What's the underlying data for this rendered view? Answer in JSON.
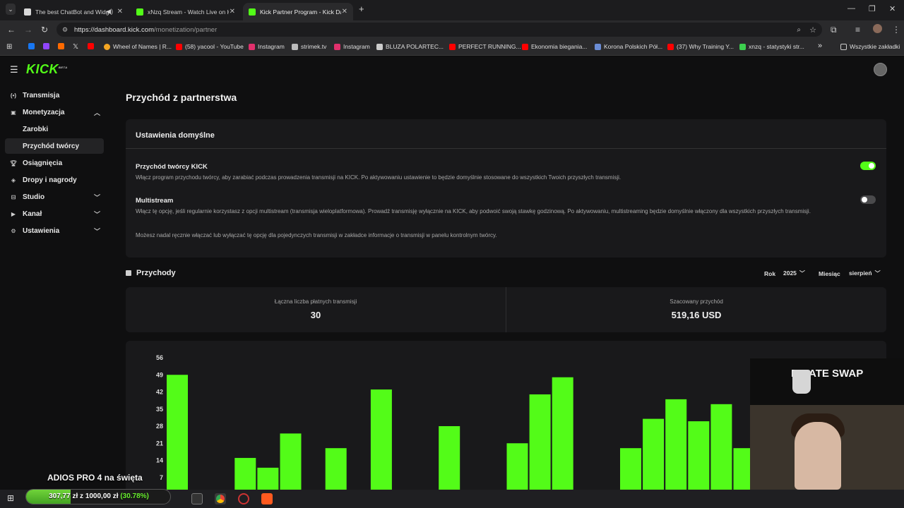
{
  "browser": {
    "tabs": [
      {
        "label": "The best ChatBot and Widg",
        "icon": "chatbot-icon",
        "color": "#d9d9d9"
      },
      {
        "label": "xNzq Stream - Watch Live on K",
        "icon": "kick-icon",
        "color": "#53fc18"
      },
      {
        "label": "Kick Partner Program - Kick Da",
        "icon": "kick-icon",
        "color": "#53fc18"
      }
    ],
    "new_tab": "+",
    "url_host": "https://dashboard.kick.com",
    "url_path": "/monetization/partner",
    "bookmarks": [
      {
        "label": "",
        "icon": "facebook-icon",
        "color": "#1877f2"
      },
      {
        "label": "",
        "icon": "twitch-icon",
        "color": "#9146ff"
      },
      {
        "label": "",
        "icon": "app-icon",
        "color": "#ff6a00"
      },
      {
        "label": "",
        "icon": "x-icon",
        "color": "#e0e0e0"
      },
      {
        "label": "",
        "icon": "youtube-icon",
        "color": "#ff0000"
      },
      {
        "label": "Wheel of Names | R...",
        "icon": "wheel-icon",
        "color": "#f5a623"
      },
      {
        "label": "(58) yacool - YouTube",
        "icon": "youtube-icon",
        "color": "#ff0000"
      },
      {
        "label": "Instagram",
        "icon": "instagram-icon",
        "color": "#e1306c"
      },
      {
        "label": "strimek.tv",
        "icon": "strimek-icon",
        "color": "#bbbbbb"
      },
      {
        "label": "Instagram",
        "icon": "instagram-icon",
        "color": "#e1306c"
      },
      {
        "label": "BLUZA POLARTEC...",
        "icon": "shop-icon",
        "color": "#cccccc"
      },
      {
        "label": "PERFECT RUNNING...",
        "icon": "youtube-icon",
        "color": "#ff0000"
      },
      {
        "label": "Ekonomia biegania...",
        "icon": "youtube-icon",
        "color": "#ff0000"
      },
      {
        "label": "Korona Polskich Pół...",
        "icon": "mountain-icon",
        "color": "#6b8dd6"
      },
      {
        "label": "(37) Why Training Y...",
        "icon": "youtube-icon",
        "color": "#ff0000"
      },
      {
        "label": "xnzq - statystyki str...",
        "icon": "stats-icon",
        "color": "#3ccf4e"
      }
    ],
    "bookmarks_more": "»",
    "all_bookmarks": "Wszystkie zakładki"
  },
  "app": {
    "logo": "KICK",
    "logo_badge": "BETA",
    "sidebar": [
      {
        "label": "Transmisja",
        "icon": "broadcast-icon",
        "chevron": ""
      },
      {
        "label": "Monetyzacja",
        "icon": "wallet-icon",
        "chevron": "⌃"
      },
      {
        "label": "Osiągnięcia",
        "icon": "trophy-icon",
        "chevron": ""
      },
      {
        "label": "Dropy i nagrody",
        "icon": "gift-icon",
        "chevron": ""
      },
      {
        "label": "Studio",
        "icon": "studio-icon",
        "chevron": "⌄"
      },
      {
        "label": "Kanał",
        "icon": "channel-icon",
        "chevron": "⌄"
      },
      {
        "label": "Ustawienia",
        "icon": "gear-icon",
        "chevron": "⌄"
      }
    ],
    "sidebar_sub": [
      {
        "label": "Zarobki"
      },
      {
        "label": "Przychód twórcy"
      }
    ],
    "page_title": "Przychód z partnerstwa",
    "settings": {
      "heading": "Ustawienia domyślne",
      "options": [
        {
          "title": "Przychód twórcy KICK",
          "desc": "Włącz program przychodu twórcy, aby zarabiać podczas prowadzenia transmisji na KICK. Po aktywowaniu ustawienie to będzie domyślnie stosowane do wszystkich Twoich przyszłych transmisji.",
          "enabled": true
        },
        {
          "title": "Multistream",
          "desc": "Włącz tę opcję, jeśli regularnie korzystasz z opcji multistream (transmisja wieloplatformowa). Prowadź transmisję wyłącznie na KICK, aby podwoić swoją stawkę godzinową. Po aktywowaniu, multistreaming będzie domyślnie włączony dla wszystkich przyszłych transmisji.",
          "enabled": false
        }
      ],
      "note": "Możesz nadal ręcznie włączać lub wyłączać tę opcję dla pojedynczych transmisji w zakładce informacje o transmisji w panelu kontrolnym twórcy."
    },
    "revenue": {
      "heading": "Przychody",
      "year_label": "Rok",
      "year_value": "2025",
      "month_label": "Miesiąc",
      "month_value": "sierpień",
      "stat1_label": "Łączna liczba płatnych transmisji",
      "stat1_value": "30",
      "stat2_label": "Szacowany przychód",
      "stat2_value": "519,16 USD"
    }
  },
  "chart_data": {
    "type": "bar",
    "color": "#53fc18",
    "yticks": [
      7,
      14,
      21,
      28,
      35,
      42,
      49,
      56
    ],
    "ylim": [
      0,
      56
    ],
    "values": [
      49,
      0,
      0,
      15,
      11,
      25,
      0,
      19,
      0,
      43,
      1,
      0,
      28,
      0,
      0,
      21,
      41,
      48,
      0,
      0,
      19,
      31,
      39,
      30,
      37,
      19,
      2
    ]
  },
  "overlay": {
    "sponsor": "PIRATE SWAP",
    "promo_text": "ADIOS PRO 4 na święta",
    "goal_current": "307,77 zł",
    "goal_sep": "z",
    "goal_target": "1000,00 zł",
    "goal_pct": "(30.78%)",
    "goal_fraction": 0.3078
  }
}
